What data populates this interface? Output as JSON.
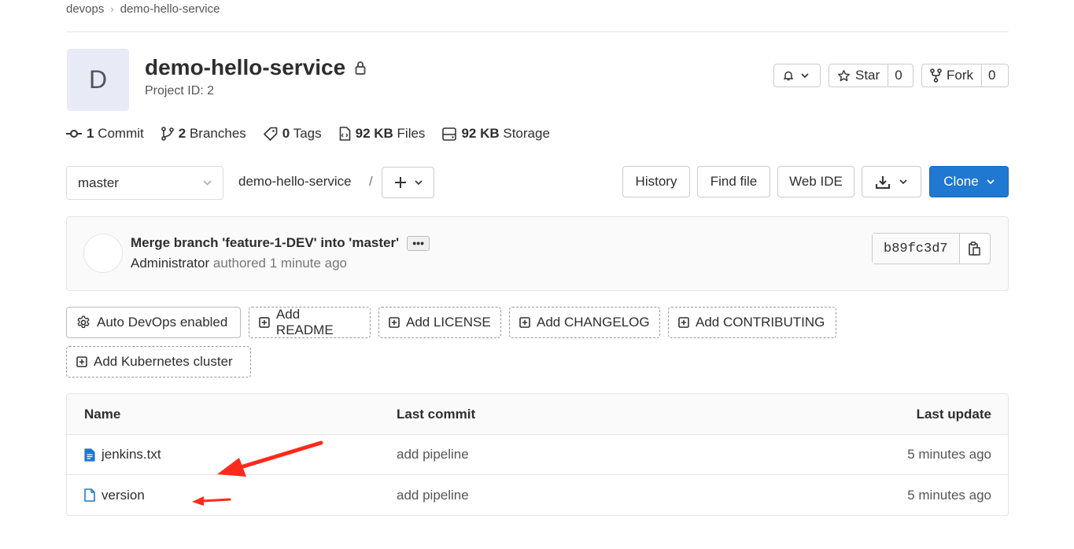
{
  "breadcrumb": {
    "group": "devops",
    "separator": "›",
    "project": "demo-hello-service"
  },
  "project": {
    "avatar_letter": "D",
    "name": "demo-hello-service",
    "id_label": "Project ID: 2"
  },
  "header_actions": {
    "star_label": "Star",
    "star_count": "0",
    "fork_label": "Fork",
    "fork_count": "0"
  },
  "stats": {
    "commits_n": "1",
    "commits_label": "Commit",
    "branches_n": "2",
    "branches_label": "Branches",
    "tags_n": "0",
    "tags_label": "Tags",
    "files_n": "92 KB",
    "files_label": "Files",
    "storage_n": "92 KB",
    "storage_label": "Storage"
  },
  "toolbar": {
    "branch": "master",
    "path": "demo-hello-service",
    "path_sep": "/",
    "history": "History",
    "find_file": "Find file",
    "web_ide": "Web IDE",
    "clone": "Clone"
  },
  "last_commit": {
    "title": "Merge branch 'feature-1-DEV' into 'master'",
    "author": "Administrator",
    "authored": "authored 1 minute ago",
    "sha": "b89fc3d7"
  },
  "quick_actions": {
    "auto_devops": "Auto DevOps enabled",
    "add_readme": "Add README",
    "add_license": "Add LICENSE",
    "add_changelog": "Add CHANGELOG",
    "add_contributing": "Add CONTRIBUTING",
    "add_k8s": "Add Kubernetes cluster"
  },
  "files_table": {
    "headers": {
      "name": "Name",
      "last_commit": "Last commit",
      "last_update": "Last update"
    },
    "rows": [
      {
        "name": "jenkins.txt",
        "commit": "add pipeline",
        "updated": "5 minutes ago"
      },
      {
        "name": "version",
        "commit": "add pipeline",
        "updated": "5 minutes ago"
      }
    ]
  },
  "colors": {
    "accent": "#1f78d1",
    "annotation": "#ff2a1a",
    "file_icon": "#1f78d1"
  }
}
